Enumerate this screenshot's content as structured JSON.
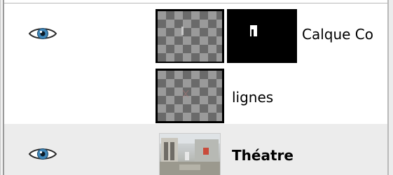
{
  "layers": [
    {
      "name": "Calque Co",
      "visible": true,
      "has_mask": true,
      "thumbnail": "transparent-checkerboard",
      "selected": false
    },
    {
      "name": "lignes",
      "visible": false,
      "has_mask": false,
      "thumbnail": "transparent-checkerboard",
      "selected": false
    },
    {
      "name": "Théatre",
      "visible": true,
      "has_mask": false,
      "thumbnail": "photo-theatre",
      "selected": true
    }
  ],
  "icons": {
    "visibility": "eye-icon"
  },
  "colors": {
    "row_background": "#ffffff",
    "active_row_background": "#ececec",
    "thumbnail_border": "#000000",
    "checker_dark": "#6a6a6a",
    "checker_light": "#9a9a9a"
  }
}
